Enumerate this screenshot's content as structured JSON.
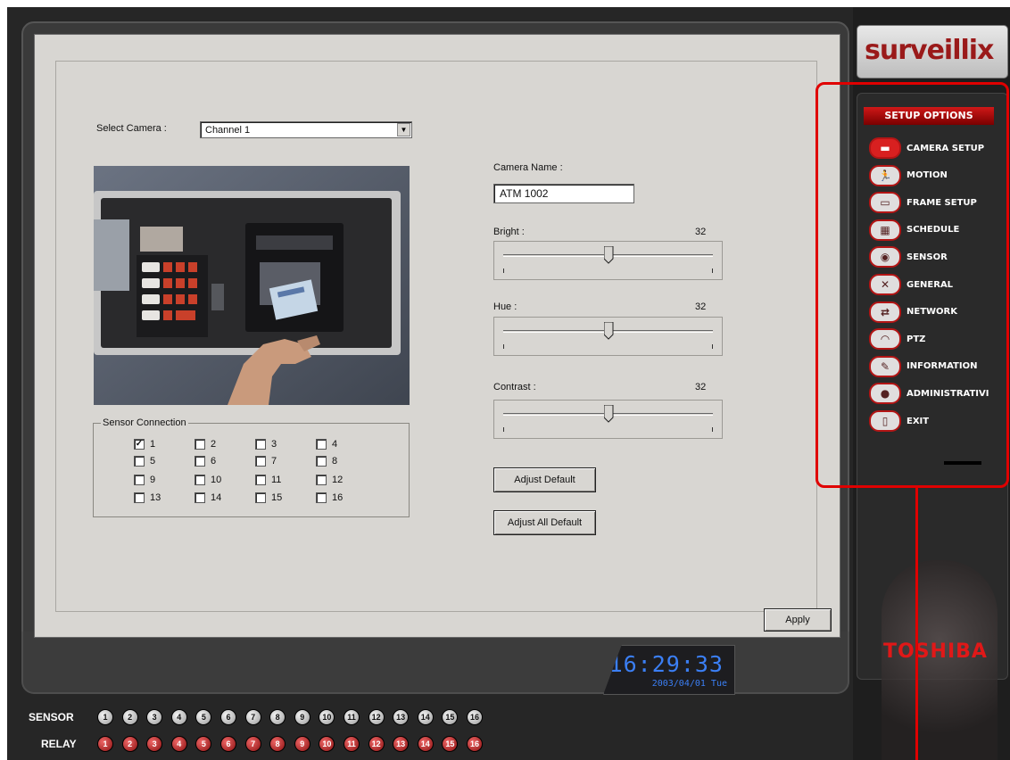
{
  "camera_setup": {
    "select_camera_label": "Select Camera :",
    "selected_camera": "Channel 1",
    "camera_name_label": "Camera Name :",
    "camera_name_value": "ATM 1002",
    "bright_label": "Bright :",
    "bright_value": "32",
    "hue_label": "Hue :",
    "hue_value": "32",
    "contrast_label": "Contrast :",
    "contrast_value": "32",
    "slider_levels": {
      "bright": 0.5,
      "hue": 0.5,
      "contrast": 0.5
    },
    "sensor_connection_label": "Sensor Connection",
    "sensors": [
      {
        "label": "1",
        "checked": true
      },
      {
        "label": "2",
        "checked": false
      },
      {
        "label": "3",
        "checked": false
      },
      {
        "label": "4",
        "checked": false
      },
      {
        "label": "5",
        "checked": false
      },
      {
        "label": "6",
        "checked": false
      },
      {
        "label": "7",
        "checked": false
      },
      {
        "label": "8",
        "checked": false
      },
      {
        "label": "9",
        "checked": false
      },
      {
        "label": "10",
        "checked": false
      },
      {
        "label": "11",
        "checked": false
      },
      {
        "label": "12",
        "checked": false
      },
      {
        "label": "13",
        "checked": false
      },
      {
        "label": "14",
        "checked": false
      },
      {
        "label": "15",
        "checked": false
      },
      {
        "label": "16",
        "checked": false
      }
    ],
    "adjust_default_label": "Adjust Default",
    "adjust_all_default_label": "Adjust All Default",
    "apply_label": "Apply"
  },
  "clock": {
    "time": "16:29:33",
    "date": "2003/04/01 Tue"
  },
  "io": {
    "sensor_label": "SENSOR",
    "relay_label": "RELAY",
    "sensor_numbers": [
      "1",
      "2",
      "3",
      "4",
      "5",
      "6",
      "7",
      "8",
      "9",
      "10",
      "11",
      "12",
      "13",
      "14",
      "15",
      "16"
    ],
    "relay_numbers": [
      "1",
      "2",
      "3",
      "4",
      "5",
      "6",
      "7",
      "8",
      "9",
      "10",
      "11",
      "12",
      "13",
      "14",
      "15",
      "16"
    ]
  },
  "sidebar": {
    "logo": "surveillix",
    "title": "SETUP OPTIONS",
    "items": [
      {
        "label": "CAMERA SETUP",
        "icon": "camera-icon"
      },
      {
        "label": "MOTION",
        "icon": "running-man-icon"
      },
      {
        "label": "FRAME SETUP",
        "icon": "film-frame-icon"
      },
      {
        "label": "SCHEDULE",
        "icon": "calendar-icon"
      },
      {
        "label": "SENSOR",
        "icon": "sensor-icon"
      },
      {
        "label": "GENERAL",
        "icon": "tools-icon"
      },
      {
        "label": "NETWORK",
        "icon": "network-icon"
      },
      {
        "label": "PTZ",
        "icon": "ptz-dome-icon"
      },
      {
        "label": "INFORMATION",
        "icon": "information-icon"
      },
      {
        "label": "ADMINISTRATIVI",
        "icon": "admin-person-icon"
      },
      {
        "label": "EXIT",
        "icon": "exit-door-icon"
      }
    ],
    "brand": "TOSHIBA"
  },
  "colors": {
    "accent_red": "#e00000",
    "clock_blue": "#3b7ff5",
    "panel_gray": "#d8d6d2"
  }
}
